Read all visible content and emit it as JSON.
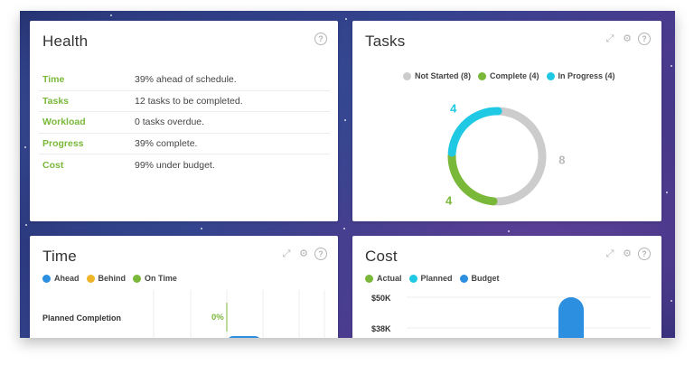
{
  "colors": {
    "green": "#7ab83a",
    "cyan": "#1fc8e3",
    "gray": "#cccccc",
    "blue": "#2d8fe0",
    "yellow": "#f0b429"
  },
  "health": {
    "title": "Health",
    "rows": [
      {
        "label": "Time",
        "value": "39% ahead of schedule."
      },
      {
        "label": "Tasks",
        "value": "12 tasks to be completed."
      },
      {
        "label": "Workload",
        "value": "0 tasks overdue."
      },
      {
        "label": "Progress",
        "value": "39% complete."
      },
      {
        "label": "Cost",
        "value": "99% under budget."
      }
    ]
  },
  "tasks": {
    "title": "Tasks",
    "legend": [
      {
        "label": "Not Started (8)",
        "color": "#cccccc"
      },
      {
        "label": "Complete (4)",
        "color": "#7ab83a"
      },
      {
        "label": "In Progress (4)",
        "color": "#1fc8e3"
      }
    ]
  },
  "time": {
    "title": "Time",
    "legend": [
      {
        "label": "Ahead",
        "color": "#2d8fe0"
      },
      {
        "label": "Behind",
        "color": "#f0b429"
      },
      {
        "label": "On Time",
        "color": "#7ab83a"
      }
    ],
    "planned_label": "Planned Completion",
    "planned_value": "0%"
  },
  "cost": {
    "title": "Cost",
    "legend": [
      {
        "label": "Actual",
        "color": "#7ab83a"
      },
      {
        "label": "Planned",
        "color": "#1fc8e3"
      },
      {
        "label": "Budget",
        "color": "#2d8fe0"
      }
    ],
    "yticks": [
      "$50K",
      "$38K"
    ]
  },
  "chart_data": [
    {
      "type": "pie",
      "categories": [
        "Not Started",
        "Complete",
        "In Progress"
      ],
      "values": [
        8,
        4,
        4
      ],
      "data_labels": [
        "8",
        "4",
        "4"
      ]
    }
  ]
}
